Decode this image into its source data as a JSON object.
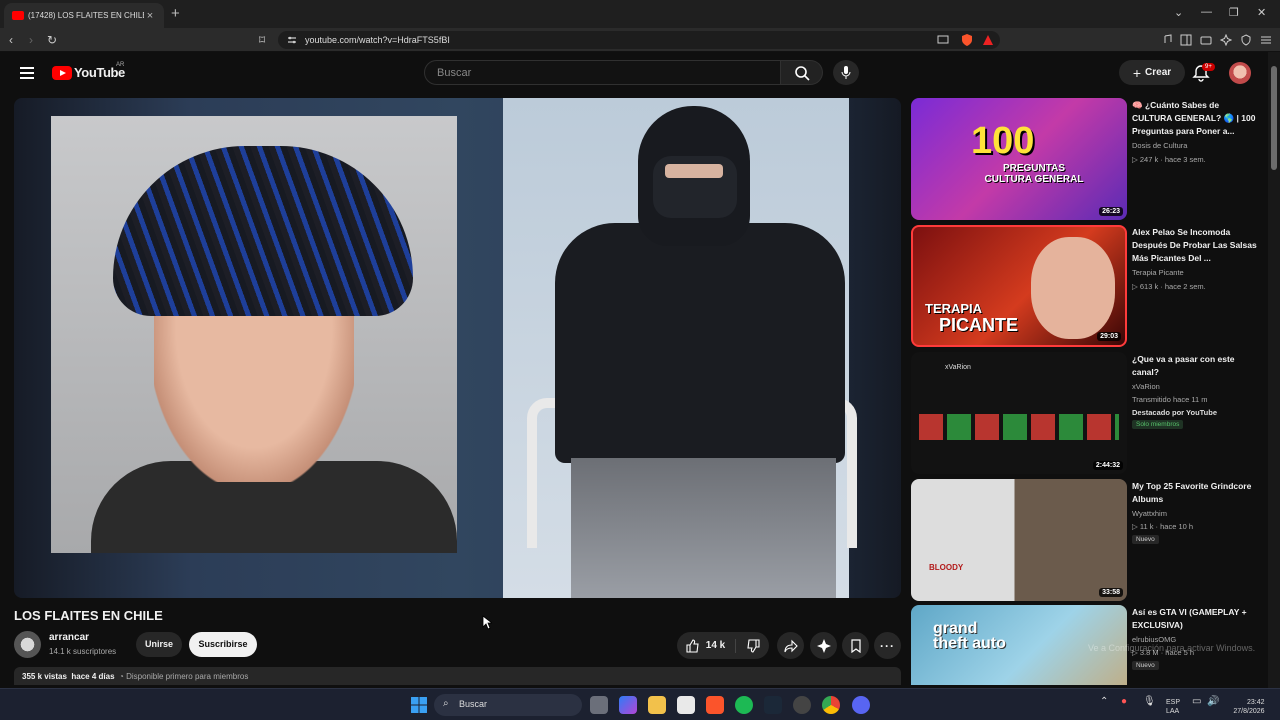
{
  "browser": {
    "tab_title": "(17428) LOS FLAITES EN CHILE",
    "new_tab": "+",
    "url": "youtube.com/watch?v=HdraFTS5fBI"
  },
  "header": {
    "logo_text": "YouTube",
    "region": "AR",
    "search_placeholder": "Buscar",
    "create_label": "Crear",
    "notif_badge": "9+"
  },
  "video": {
    "title": "LOS FLAITES EN CHILE",
    "channel": "arrancar",
    "subscribers": "14.1 k suscriptores",
    "join_label": "Unirse",
    "subscribe_label": "Suscribirse",
    "likes": "14 k",
    "views": "355 k vistas",
    "age": "hace 4 días",
    "members_note": "Disponible primero para miembros"
  },
  "sidebar": [
    {
      "title": "🧠 ¿Cuánto Sabes de CULTURA GENERAL? 🌎 | 100 Preguntas para Poner a...",
      "channel": "Dosis de Cultura",
      "meta": "▷ 247 k · hace 3 sem.",
      "duration": "26:23",
      "thumb_text": "100",
      "thumb_sub": "PREGUNTAS CULTURA GENERAL"
    },
    {
      "title": "Alex Pelao Se Incomoda Después De Probar Las Salsas Más Picantes Del ...",
      "channel": "Terapia Picante",
      "meta": "▷ 613 k · hace 2 sem.",
      "duration": "29:03",
      "thumb_text": "TERAPIA",
      "thumb_sub": "PICANTE"
    },
    {
      "title": "¿Que va a pasar con este canal?",
      "channel": "xVaRion",
      "meta": "Transmitido hace 11 m",
      "featured": "Destacado por YouTube",
      "members": "Solo miembros",
      "duration": "2:44:32",
      "thumb_text": "xVaRion"
    },
    {
      "title": "My Top 25 Favorite Grindcore Albums",
      "channel": "Wyattxhim",
      "meta": "▷ 11 k · hace 10 h",
      "tag": "Nuevo",
      "duration": "33:58",
      "thumb_text": "BLOODY"
    },
    {
      "title": "Así es GTA VI (GAMEPLAY + EXCLUSIVA)",
      "channel": "elrubiusOMG",
      "meta": "▷ 3.8 M · hace 5 h",
      "tag": "Nuevo",
      "duration": "",
      "thumb_text": "grand theft auto"
    }
  ],
  "watermark": "Ve a Configuración para activar Windows.",
  "taskbar": {
    "search_label": "Buscar",
    "lang1": "ESP",
    "lang2": "LAA",
    "time": "23:42",
    "date": "27/8/2026"
  }
}
